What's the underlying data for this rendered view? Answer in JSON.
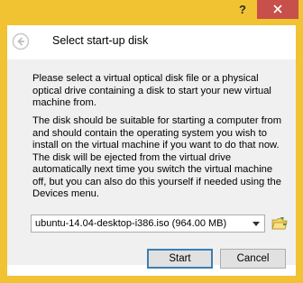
{
  "window": {
    "help_label": "?",
    "close_icon": "close-icon"
  },
  "header": {
    "back_icon": "back-arrow-icon",
    "title": "Select start-up disk"
  },
  "body": {
    "paragraph1": "Please select a virtual optical disk file or a physical optical drive containing a disk to start your new virtual machine from.",
    "paragraph2": "The disk should be suitable for starting a computer from and should contain the operating system you wish to install on the virtual machine if you want to do that now. The disk will be ejected from the virtual drive automatically next time you switch the virtual machine off, but you can also do this yourself if needed using the Devices menu."
  },
  "disk_selector": {
    "selected": "ubuntu-14.04-desktop-i386.iso (964.00 MB)",
    "folder_icon": "folder-browse-icon"
  },
  "buttons": {
    "start": "Start",
    "cancel": "Cancel"
  },
  "colors": {
    "frame": "#f1c232",
    "close": "#c7504a",
    "accent": "#3c7fb1"
  }
}
